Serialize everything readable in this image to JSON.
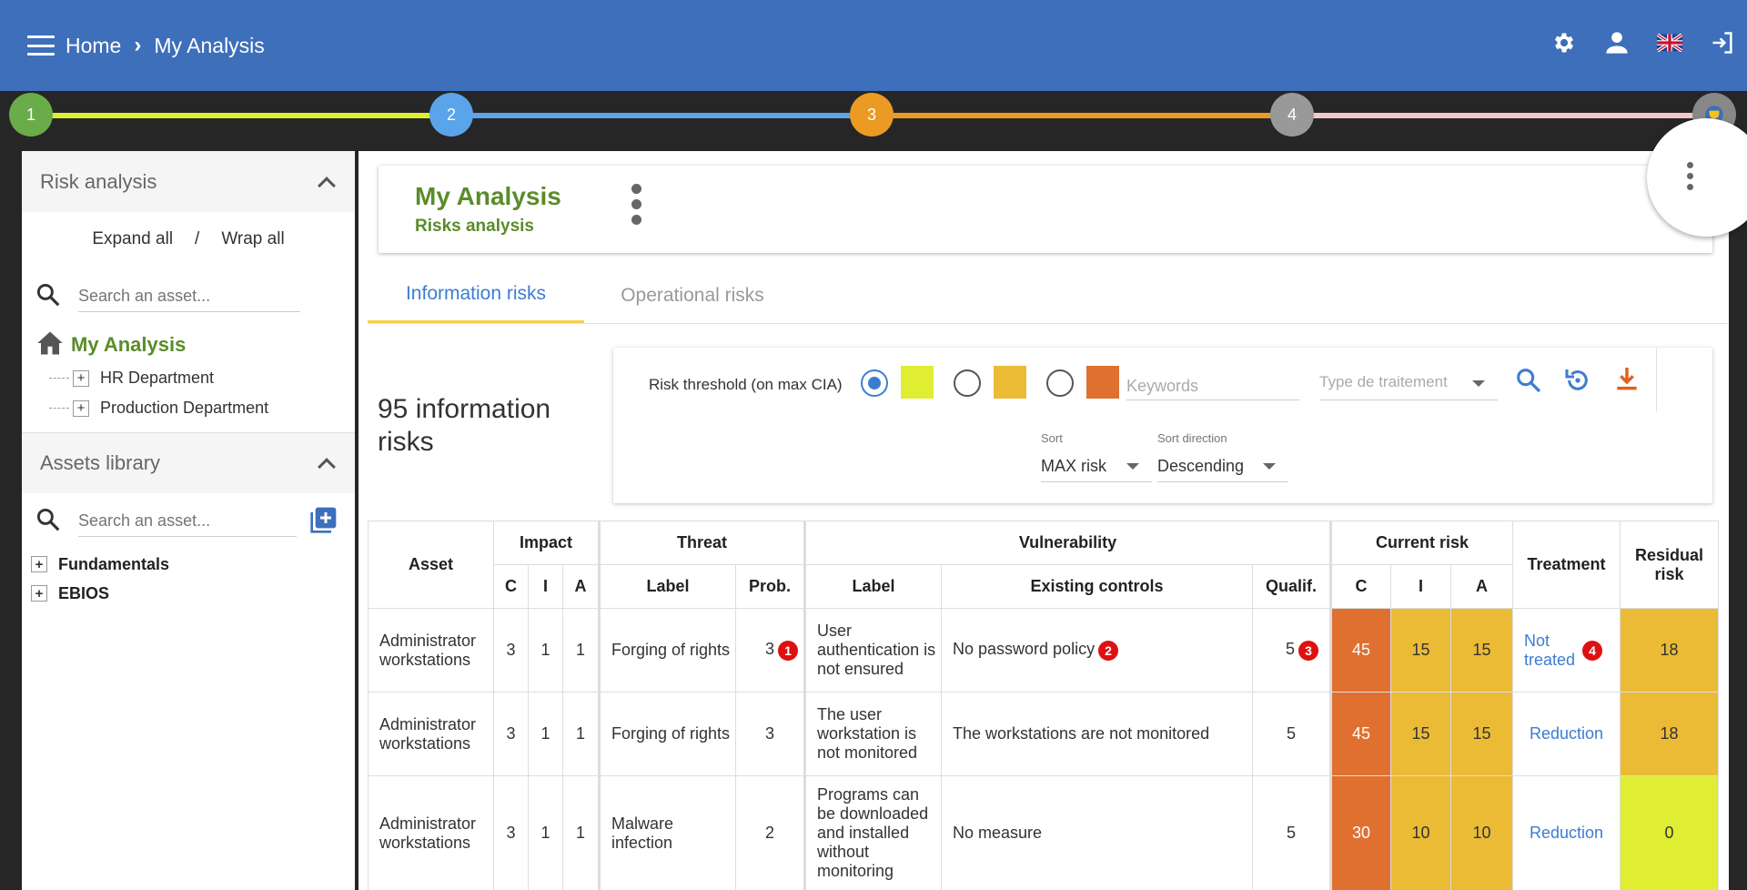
{
  "topbar": {
    "home": "Home",
    "current": "My Analysis",
    "icons": [
      "menu-icon",
      "chevron-right-icon",
      "settings-icon",
      "user-icon",
      "uk-flag-icon",
      "logout-icon"
    ]
  },
  "stepper": {
    "steps": [
      {
        "label": "1",
        "color": "#6aac49"
      },
      {
        "label": "2",
        "color": "#5aa4ea"
      },
      {
        "label": "3",
        "color": "#eb9b23"
      },
      {
        "label": "4",
        "color": "#999999"
      }
    ],
    "segment_colors": [
      "#dfed33",
      "#5aa4ea",
      "#eb9b23",
      "#f3c8c8"
    ]
  },
  "sidebar": {
    "risk_analysis": {
      "title": "Risk analysis",
      "expand_all": "Expand all",
      "separator": "/",
      "wrap_all": "Wrap all",
      "search_placeholder": "Search an asset...",
      "tree_root": "My Analysis",
      "children": [
        "HR Department",
        "Production Department"
      ]
    },
    "assets_library": {
      "title": "Assets library",
      "search_placeholder": "Search an asset...",
      "items": [
        "Fundamentals",
        "EBIOS"
      ]
    }
  },
  "main": {
    "title": "My Analysis",
    "subtitle": "Risks analysis",
    "tabs": [
      {
        "label": "Information risks",
        "active": true
      },
      {
        "label": "Operational risks",
        "active": false
      }
    ],
    "count_line1": "95 information",
    "count_line2": "risks",
    "filters": {
      "threshold_label": "Risk threshold (on max CIA)",
      "swatch_colors": [
        "#dfed33",
        "#ebbb36",
        "#e07030"
      ],
      "keywords_placeholder": "Keywords",
      "treatment_placeholder": "Type de traitement",
      "sort_label": "Sort",
      "sort_value": "MAX risk",
      "direction_label": "Sort direction",
      "direction_value": "Descending"
    }
  },
  "table": {
    "headers": {
      "asset": "Asset",
      "impact": "Impact",
      "threat": "Threat",
      "vulnerability": "Vulnerability",
      "current_risk": "Current risk",
      "treatment": "Treatment",
      "residual_risk": "Residual risk",
      "c": "C",
      "i": "I",
      "a": "A",
      "label": "Label",
      "prob": "Prob.",
      "vlabel": "Label",
      "existing": "Existing controls",
      "qualif": "Qualif."
    },
    "rows": [
      {
        "asset": "Administrator workstations",
        "c": "3",
        "i": "1",
        "a": "1",
        "threat": "Forging of rights",
        "prob": "3",
        "vuln": "User authentication is not ensured",
        "controls": "No password policy",
        "qualif": "5",
        "rc": "45",
        "ri": "15",
        "ra": "15",
        "treatment": "Not treated",
        "residual": "18",
        "badges": {
          "prob": "1",
          "controls": "2",
          "qualif": "3",
          "treatment": "4"
        }
      },
      {
        "asset": "Administrator workstations",
        "c": "3",
        "i": "1",
        "a": "1",
        "threat": "Forging of rights",
        "prob": "3",
        "vuln": "The user workstation is not monitored",
        "controls": "The workstations are not monitored",
        "qualif": "5",
        "rc": "45",
        "ri": "15",
        "ra": "15",
        "treatment": "Reduction",
        "residual": "18"
      },
      {
        "asset": "Administrator workstations",
        "c": "3",
        "i": "1",
        "a": "1",
        "threat": "Malware infection",
        "prob": "2",
        "vuln": "Programs can be downloaded and installed without monitoring",
        "controls": "No measure",
        "qualif": "5",
        "rc": "30",
        "ri": "10",
        "ra": "10",
        "treatment": "Reduction",
        "residual": "0"
      }
    ]
  }
}
